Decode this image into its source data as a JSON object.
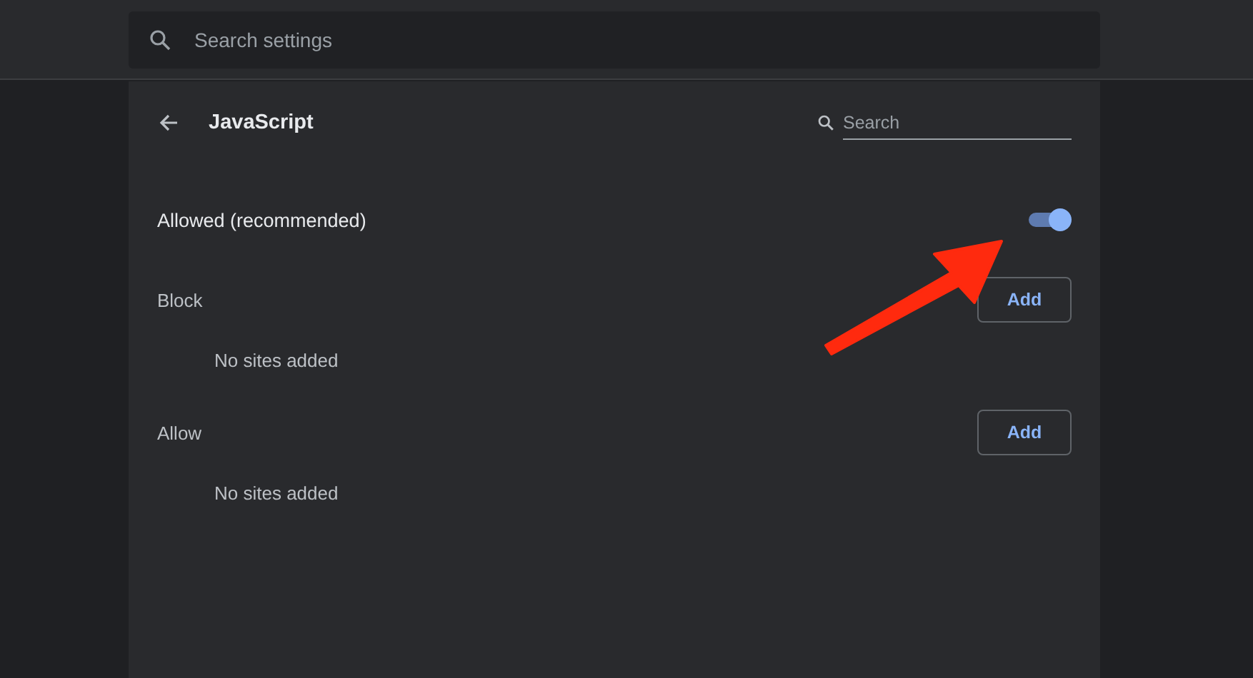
{
  "search_settings": {
    "placeholder": "Search settings"
  },
  "page": {
    "title": "JavaScript",
    "search": {
      "placeholder": "Search"
    }
  },
  "setting": {
    "label": "Allowed (recommended)",
    "on": true
  },
  "sections": [
    {
      "title": "Block",
      "button": "Add",
      "empty": "No sites added"
    },
    {
      "title": "Allow",
      "button": "Add",
      "empty": "No sites added"
    }
  ],
  "annotation": {
    "kind": "arrow"
  }
}
